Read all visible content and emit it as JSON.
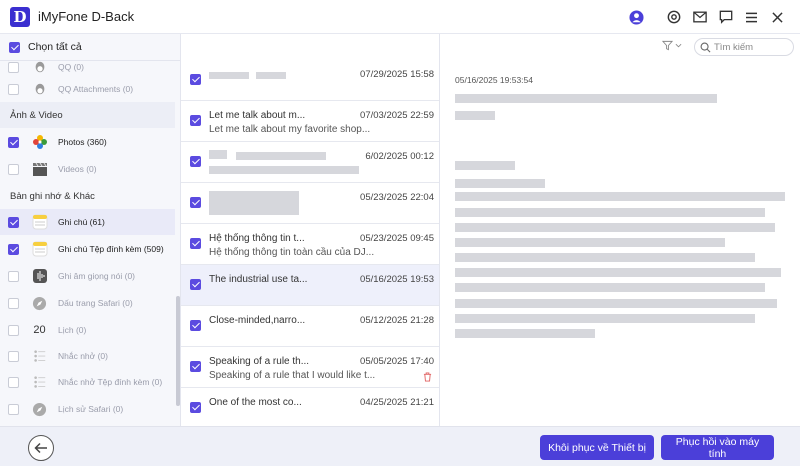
{
  "app": {
    "title": "iMyFone D-Back",
    "logo_letter": "D"
  },
  "left_panel": {
    "select_all_label": "Chọn tất cả",
    "rows": [
      {
        "label": "QQ (0)",
        "type": "item",
        "checked": false,
        "dark": false
      },
      {
        "label": "QQ Attachments (0)",
        "type": "item",
        "checked": false,
        "dark": false
      },
      {
        "label": "Ảnh & Video",
        "type": "section"
      },
      {
        "label": "Photos (360)",
        "type": "item",
        "checked": true,
        "dark": true
      },
      {
        "label": "Videos (0)",
        "type": "item",
        "checked": false,
        "dark": false
      },
      {
        "label": "Bản ghi nhớ & Khác",
        "type": "section"
      },
      {
        "label": "Ghi chú (61)",
        "type": "item",
        "checked": true,
        "dark": true,
        "selected": true
      },
      {
        "label": "Ghi chú Tệp đính kèm (509)",
        "type": "item",
        "checked": true,
        "dark": true
      },
      {
        "label": "Ghi âm giọng nói (0)",
        "type": "item",
        "checked": false,
        "dark": false
      },
      {
        "label": "Dấu trang Safari (0)",
        "type": "item",
        "checked": false,
        "dark": false
      },
      {
        "label": "Lịch (0)",
        "type": "item",
        "checked": false,
        "dark": false
      },
      {
        "label": "Nhắc nhở (0)",
        "type": "item",
        "checked": false,
        "dark": false
      },
      {
        "label": "Nhắc nhở Tệp đính kèm (0)",
        "type": "item",
        "checked": false,
        "dark": false
      },
      {
        "label": "Lịch sử Safari (0)",
        "type": "item",
        "checked": false,
        "dark": false
      }
    ]
  },
  "messages": [
    {
      "line1": "",
      "line2": "",
      "date": "07/29/2025 15:58",
      "blurred": true
    },
    {
      "line1": "Let me talk about m...",
      "line2": "Let me talk about my favorite shop...",
      "date": "07/03/2025 22:59"
    },
    {
      "line1": "",
      "line2": "",
      "date": "6/02/2025 00:12",
      "blurred": true
    },
    {
      "line1": "",
      "line2": "",
      "date": "05/23/2025 22:04",
      "blurred": true
    },
    {
      "line1": "Hệ thống thông tin t...",
      "line2": "Hệ thống thông tin toàn cầu của DJ...",
      "date": "05/23/2025 09:45"
    },
    {
      "line1": "The industrial use ta...",
      "line2": "",
      "date": "05/16/2025 19:53",
      "selected": true
    },
    {
      "line1": "Close-minded,narro...",
      "line2": "",
      "date": "05/12/2025 21:28"
    },
    {
      "line1": "Speaking of a rule th...",
      "line2": "Speaking of a rule that I would like t...",
      "date": "05/05/2025 17:40",
      "trash": true
    },
    {
      "line1": "One of the most co...",
      "line2": "",
      "date": "04/25/2025 21:21"
    }
  ],
  "search": {
    "placeholder": "Tìm kiếm"
  },
  "detail": {
    "date": "05/16/2025 19:53:54"
  },
  "bottom": {
    "restore_device_label": "Khôi phục về Thiết bị",
    "restore_computer_label": "Phục hồi vào máy tính"
  },
  "colors": {
    "accent": "#4b3fd9",
    "checkbox": "#5b4be0"
  },
  "icons": [
    "user-icon",
    "target-icon",
    "mail-icon",
    "chat-icon",
    "menu-icon",
    "close-icon",
    "filter-icon",
    "search-icon",
    "back-arrow-icon",
    "trash-icon"
  ]
}
